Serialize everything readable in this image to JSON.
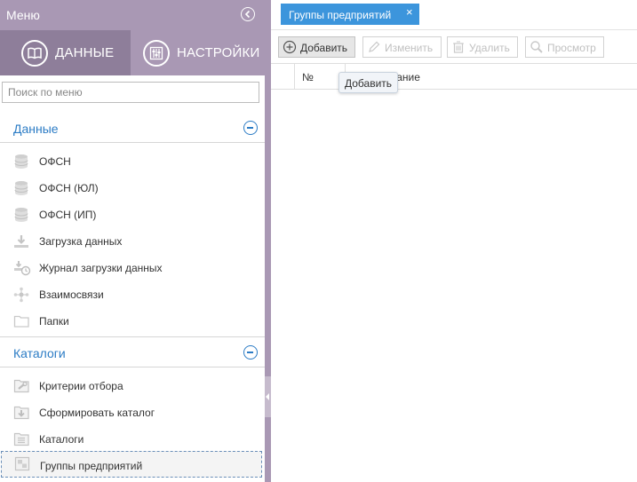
{
  "sidebar": {
    "title": "Меню",
    "tabs": [
      {
        "label": "ДАННЫЕ",
        "icon": "book-icon"
      },
      {
        "label": "НАСТРОЙКИ",
        "icon": "sliders-icon"
      }
    ],
    "search_placeholder": "Поиск по меню",
    "sections": [
      {
        "title": "Данные",
        "items": [
          {
            "label": "ОФСН",
            "icon": "database-icon"
          },
          {
            "label": "ОФСН (ЮЛ)",
            "icon": "database-icon"
          },
          {
            "label": "ОФСН (ИП)",
            "icon": "database-icon"
          },
          {
            "label": "Загрузка данных",
            "icon": "upload-icon"
          },
          {
            "label": "Журнал загрузки данных",
            "icon": "load-log-icon"
          },
          {
            "label": "Взаимосвязи",
            "icon": "relations-icon"
          },
          {
            "label": "Папки",
            "icon": "folder-icon"
          }
        ]
      },
      {
        "title": "Каталоги",
        "items": [
          {
            "label": "Критерии отбора",
            "icon": "filter-criteria-icon"
          },
          {
            "label": "Сформировать каталог",
            "icon": "form-catalog-icon"
          },
          {
            "label": "Каталоги",
            "icon": "catalogs-icon"
          },
          {
            "label": "Группы предприятий",
            "icon": "enterprise-groups-icon"
          }
        ]
      }
    ]
  },
  "main": {
    "tab_label": "Группы предприятий",
    "tab_close": "×",
    "toolbar": {
      "add": "Добавить",
      "edit": "Изменить",
      "delete": "Удалить",
      "view": "Просмотр"
    },
    "grid": {
      "col_number": "№",
      "col_name_partial": "вание"
    },
    "tooltip": "Добавить"
  },
  "colors": {
    "sidebar_header": "#a998b4",
    "active_tab": "#8e7e9a",
    "accent_blue": "#2c7cc5",
    "doc_tab": "#3c95dc"
  }
}
